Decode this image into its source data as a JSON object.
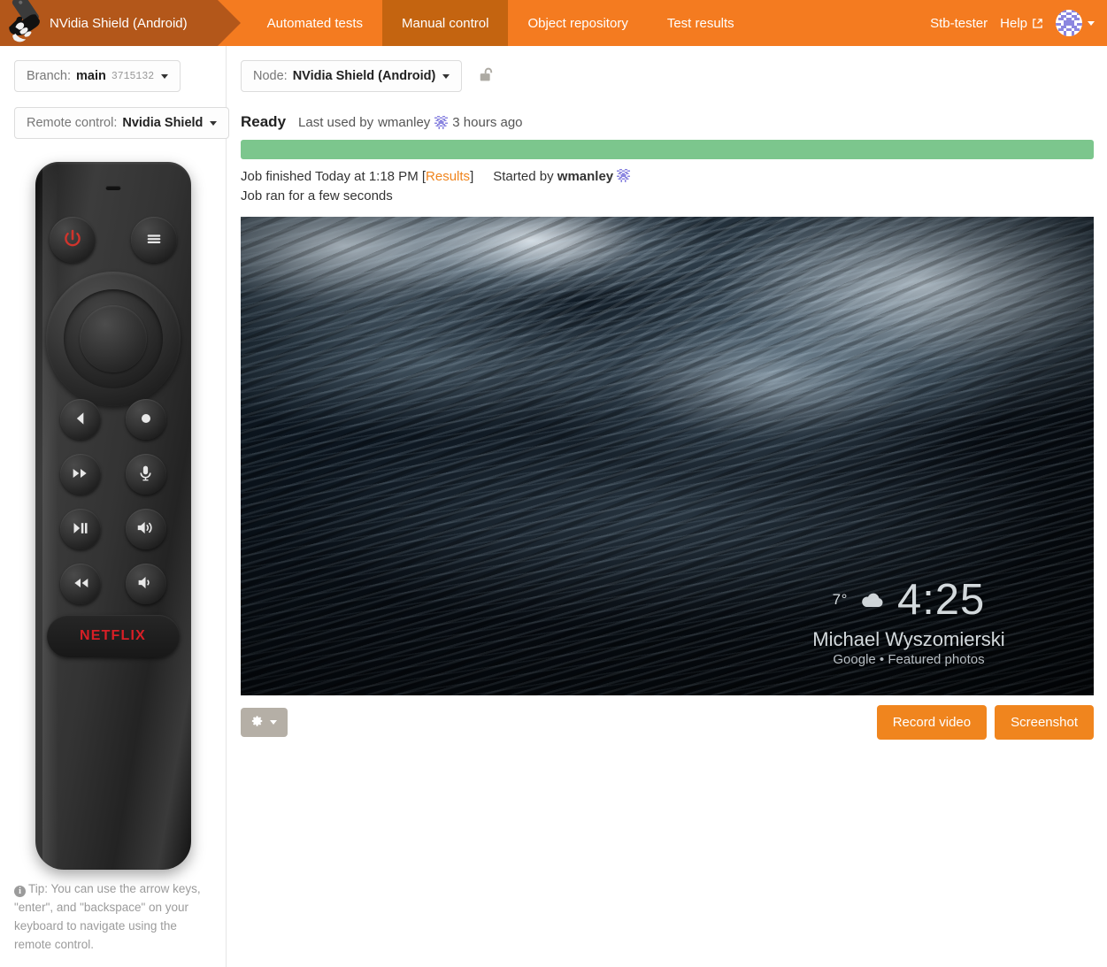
{
  "header": {
    "logo_icon": "hand-holding-remote-icon",
    "brand": "NVidia Shield (Android)",
    "tabs": [
      {
        "label": "Automated tests",
        "active": false
      },
      {
        "label": "Manual control",
        "active": true
      },
      {
        "label": "Object repository",
        "active": false
      },
      {
        "label": "Test results",
        "active": false
      }
    ],
    "user": "Stb-tester",
    "help": "Help",
    "help_icon": "external-link-icon",
    "avatar_icon": "user-avatar-identicon",
    "caret_icon": "chevron-down-icon",
    "bg_color": "#f47b20",
    "active_tab_color": "#c46410",
    "brand_color": "#b3571a"
  },
  "sidebar": {
    "branch": {
      "prefix": "Branch:",
      "name": "main",
      "sha": "3715132"
    },
    "remote_control": {
      "prefix": "Remote control:",
      "name": "Nvidia Shield"
    },
    "remote_buttons": [
      {
        "name": "power-button",
        "icon": "power-icon"
      },
      {
        "name": "menu-button",
        "icon": "hamburger-menu-icon"
      },
      {
        "name": "dpad",
        "icon": "dpad-icon"
      },
      {
        "name": "back-button",
        "icon": "back-triangle-icon"
      },
      {
        "name": "home-button",
        "icon": "circle-dot-icon"
      },
      {
        "name": "fast-forward-button",
        "icon": "fast-forward-icon"
      },
      {
        "name": "voice-search-button",
        "icon": "microphone-icon"
      },
      {
        "name": "play-pause-button",
        "icon": "play-pause-icon"
      },
      {
        "name": "volume-up-button",
        "icon": "volume-up-icon"
      },
      {
        "name": "rewind-button",
        "icon": "rewind-icon"
      },
      {
        "name": "volume-down-button",
        "icon": "volume-down-icon"
      },
      {
        "name": "netflix-button",
        "icon": "netflix-logo"
      }
    ],
    "netflix_label": "NETFLIX",
    "netflix_color": "#d81f26",
    "tip": "Tip: You can use the arrow keys, \"enter\", and \"backspace\" on your keyboard to navigate using the remote control."
  },
  "main": {
    "node": {
      "prefix": "Node:",
      "name": "NVidia Shield (Android)"
    },
    "lock_icon": "unlocked-padlock-icon",
    "status": {
      "state": "Ready",
      "last_used_prefix": "Last used by",
      "last_used_by": "wmanley",
      "last_used_when": "3 hours ago",
      "progress_color": "#7cc68d"
    },
    "job": {
      "finished_text": "Job finished Today at 1:18 PM [",
      "results_link": "Results",
      "finished_suffix": "]",
      "started_prefix": "Started by",
      "started_by": "wmanley",
      "duration": "Job ran for a few seconds"
    },
    "screen": {
      "temperature": "7°",
      "weather_icon": "cloud-icon",
      "clock": "4:25",
      "photo_author": "Michael Wyszomierski",
      "photo_source": "Google • Featured photos"
    },
    "actions": {
      "settings_icon": "gear-icon",
      "settings_caret": "chevron-down-icon",
      "record_video": "Record video",
      "screenshot": "Screenshot",
      "button_color": "#f0851e"
    }
  }
}
